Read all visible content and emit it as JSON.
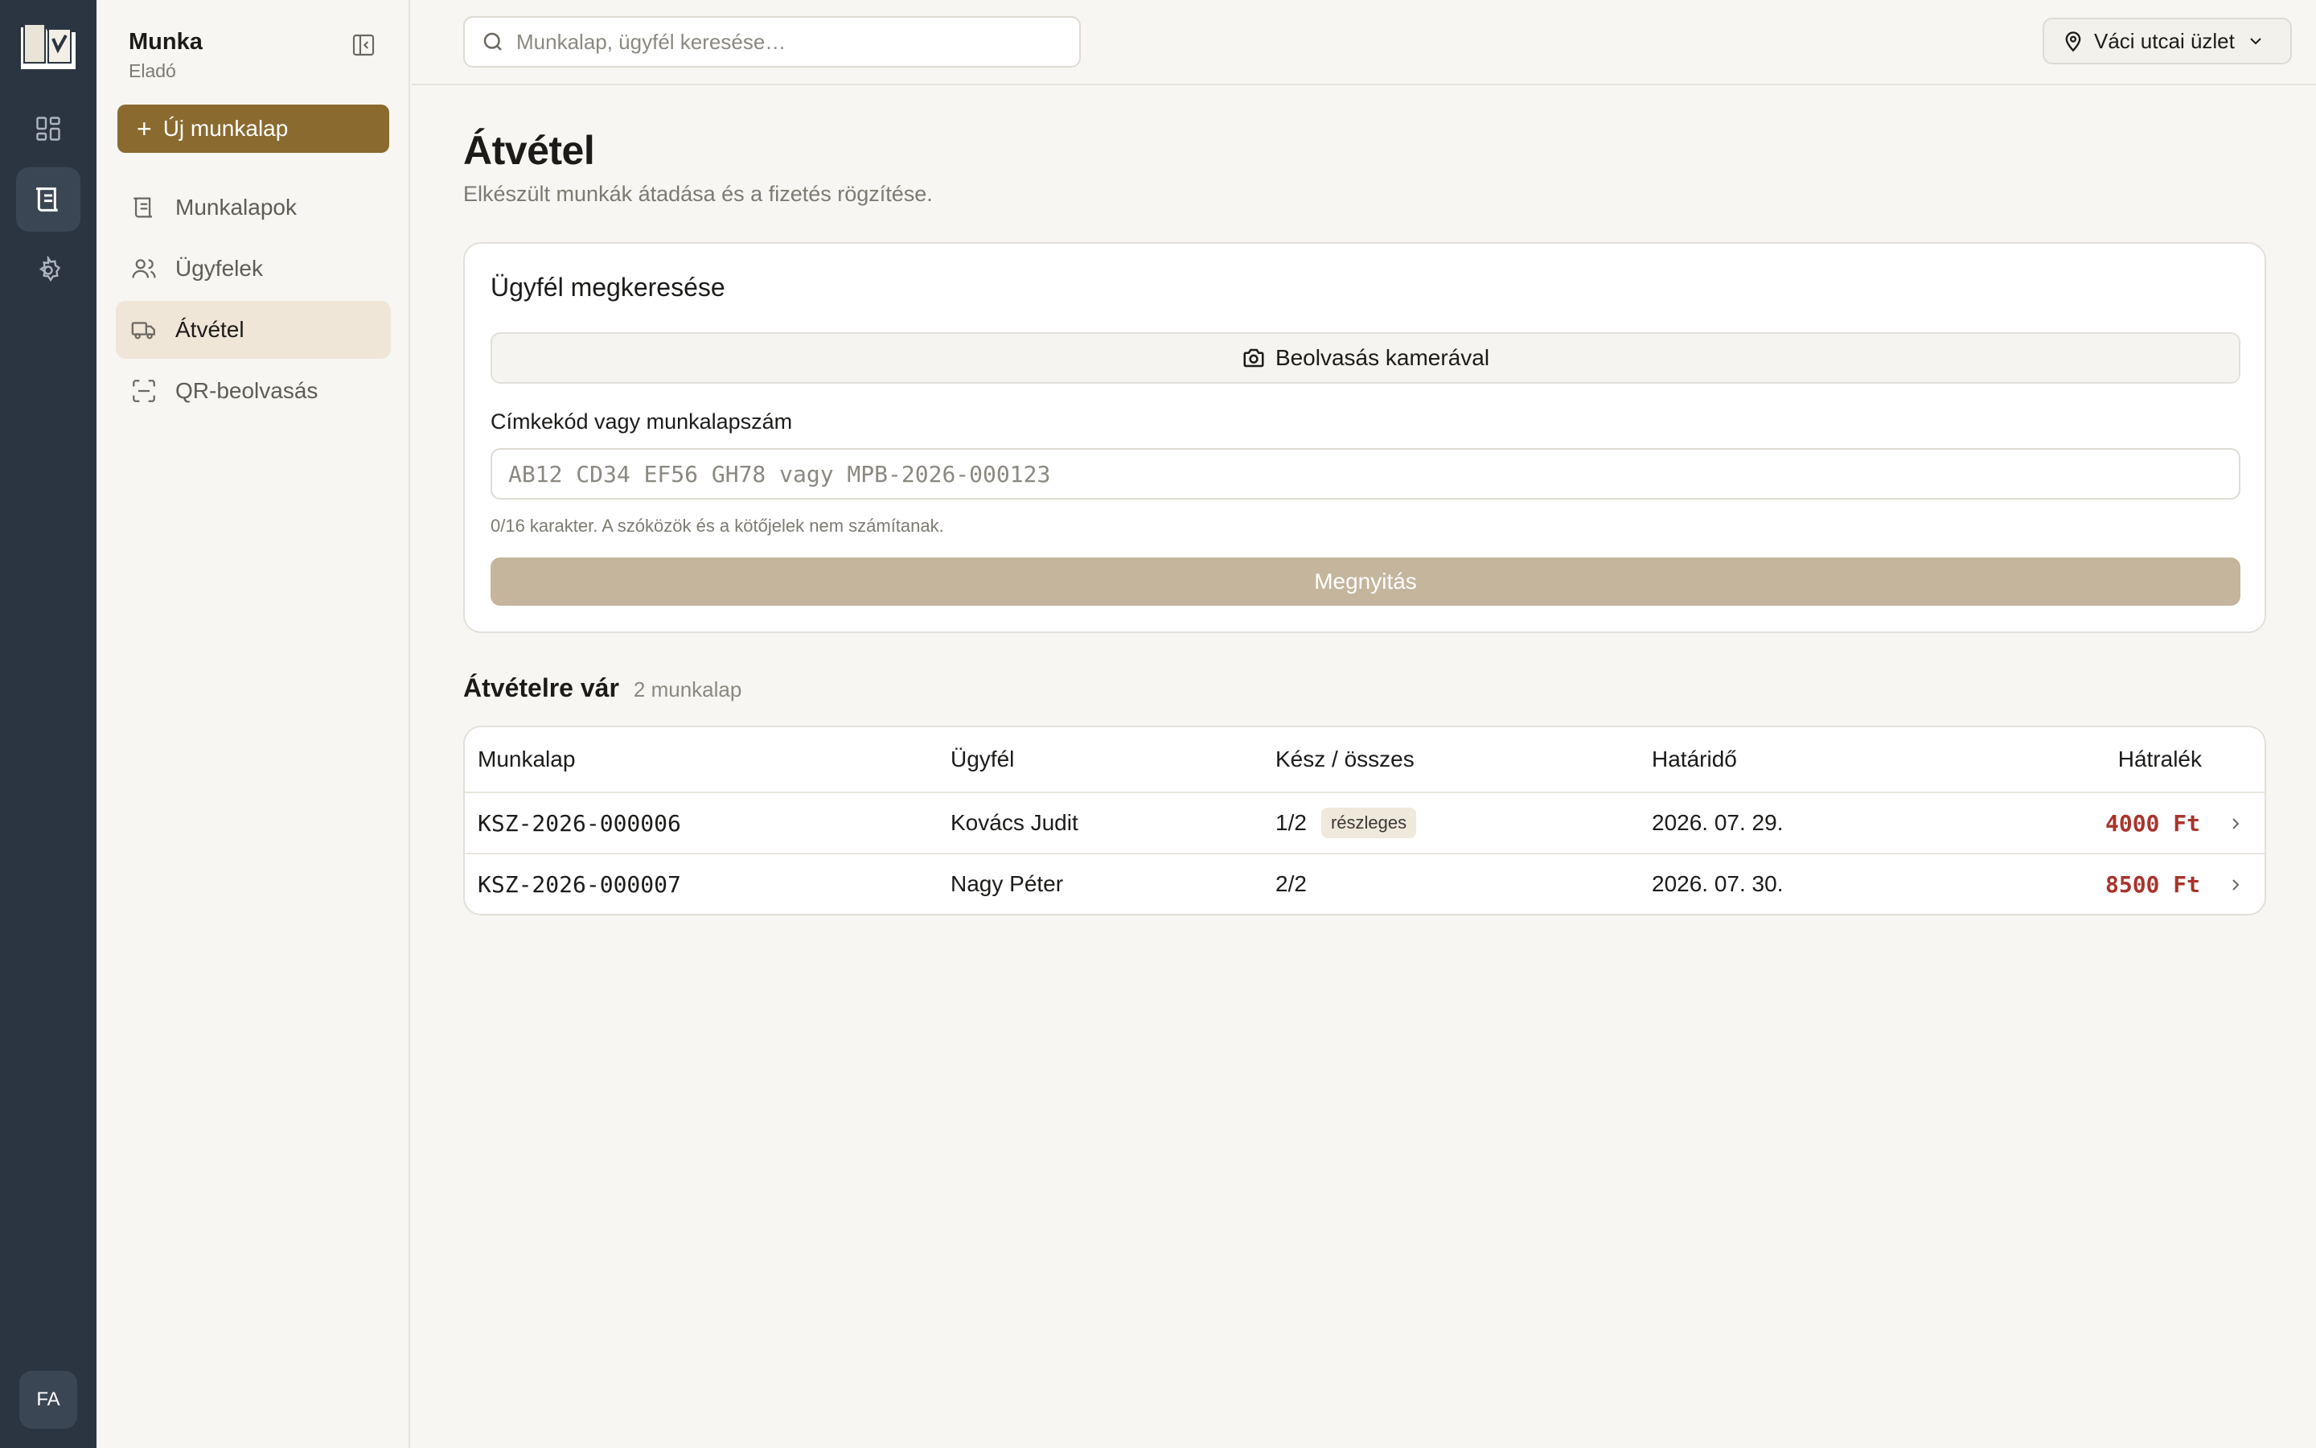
{
  "rail": {
    "avatar_initials": "FA"
  },
  "sidebar": {
    "title": "Munka",
    "subtitle": "Eladó",
    "new_button": "Új munkalap",
    "items": [
      {
        "label": "Munkalapok",
        "icon": "receipt-icon",
        "active": false
      },
      {
        "label": "Ügyfelek",
        "icon": "users-icon",
        "active": false
      },
      {
        "label": "Átvétel",
        "icon": "truck-icon",
        "active": true
      },
      {
        "label": "QR-beolvasás",
        "icon": "scan-icon",
        "active": false
      }
    ]
  },
  "topbar": {
    "search_placeholder": "Munkalap, ügyfél keresése…",
    "location": "Váci utcai üzlet"
  },
  "page": {
    "title": "Átvétel",
    "subtitle": "Elkészült munkák átadása és a fizetés rögzítése."
  },
  "lookup": {
    "title": "Ügyfél megkeresése",
    "camera_button": "Beolvasás kamerával",
    "field_label": "Címkekód vagy munkalapszám",
    "field_placeholder": "AB12 CD34 EF56 GH78 vagy MPB-2026-000123",
    "hint": "0/16 karakter. A szóközök és a kötőjelek nem számítanak.",
    "open_button": "Megnyitás"
  },
  "pending": {
    "title": "Átvételre vár",
    "count": "2 munkalap",
    "columns": [
      "Munkalap",
      "Ügyfél",
      "Kész / összes",
      "Határidő",
      "Hátralék"
    ],
    "rows": [
      {
        "id": "KSZ-2026-000006",
        "customer": "Kovács Judit",
        "progress": "1/2",
        "badge": "részleges",
        "deadline": "2026. 07. 29.",
        "due": "4000 Ft"
      },
      {
        "id": "KSZ-2026-000007",
        "customer": "Nagy Péter",
        "progress": "2/2",
        "badge": "",
        "deadline": "2026. 07. 30.",
        "due": "8500 Ft"
      }
    ]
  },
  "colors": {
    "rail_bg": "#2b3542",
    "accent": "#8a6a2f",
    "active_nav_bg": "#efe6d8",
    "disabled_button": "#c4b59c",
    "amount_due": "#a8342b"
  }
}
